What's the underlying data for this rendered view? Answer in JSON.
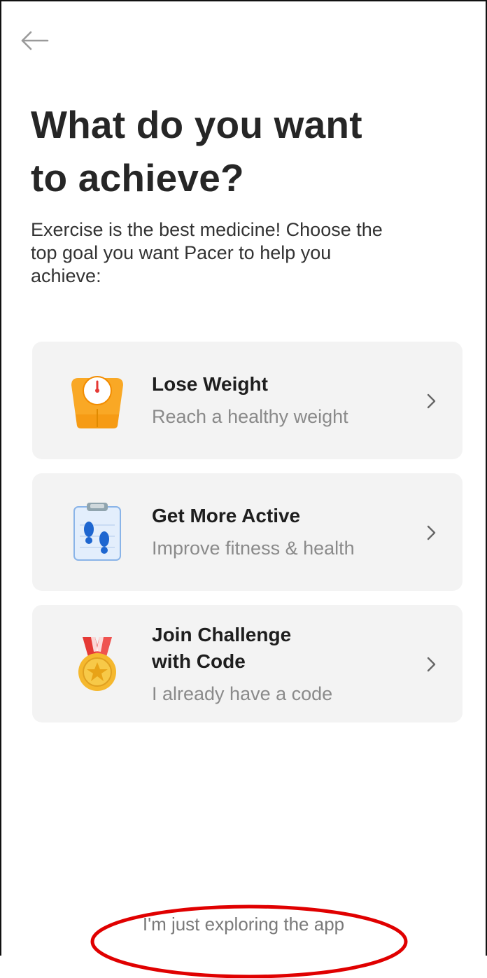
{
  "header": {
    "back_icon": "arrow-left-icon",
    "title_line1": "What do you want",
    "title_line2": "to achieve?",
    "subtitle_line1": "Exercise is the best medicine! Choose the",
    "subtitle_line2": "top goal you want Pacer to help you",
    "subtitle_line3": "achieve:"
  },
  "goals": [
    {
      "icon": "scale-icon",
      "name_line1": "Lose Weight",
      "name_line2": "",
      "description": "Reach a healthy weight"
    },
    {
      "icon": "clipboard-footprints-icon",
      "name_line1": "Get More Active",
      "name_line2": "",
      "description": "Improve fitness & health"
    },
    {
      "icon": "medal-icon",
      "name_line1": "Join Challenge",
      "name_line2": "with Code",
      "description": "I already have a code"
    }
  ],
  "footer": {
    "explore_label": "I'm just exploring the app"
  },
  "colors": {
    "card_background": "#f3f3f3",
    "scale_orange": "#f9a825",
    "clipboard_blue": "#1e88e5",
    "medal_gold": "#f5b82e",
    "ribbon_red": "#e53935",
    "annotation_red": "#e00000"
  }
}
